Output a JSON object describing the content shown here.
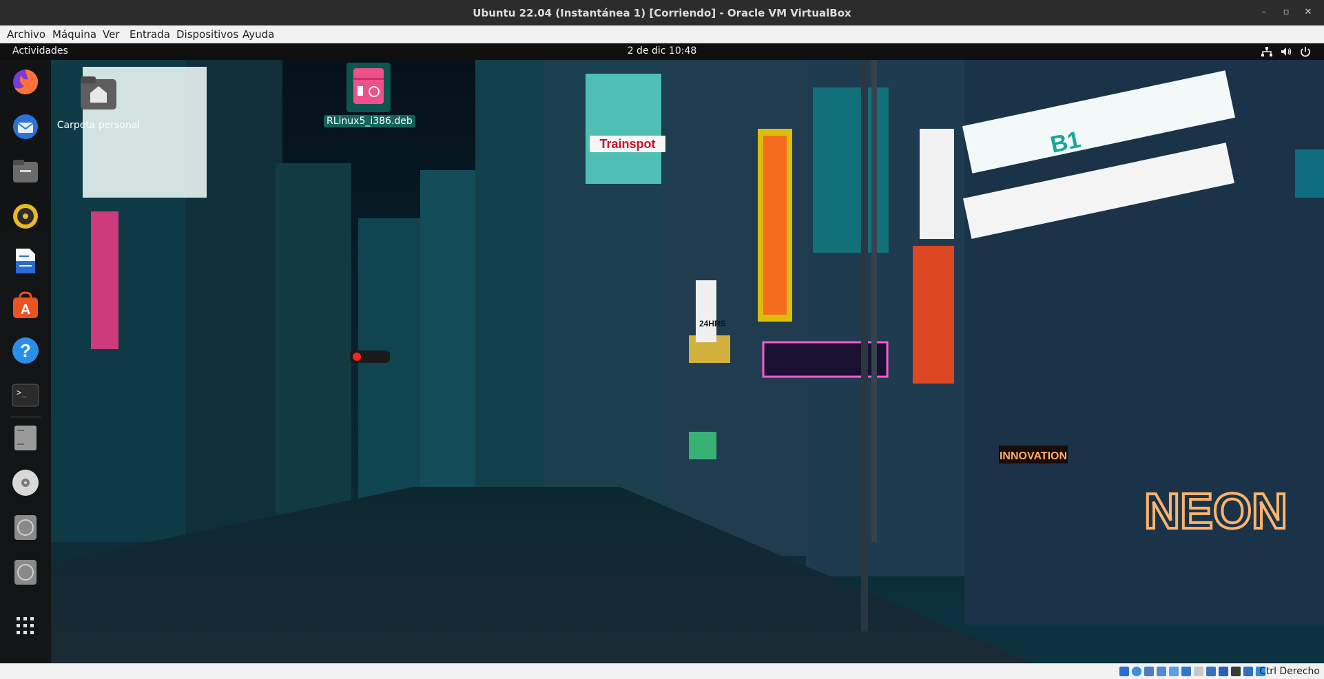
{
  "window": {
    "title": "Ubuntu 22.04 (Instantánea 1) [Corriendo] - Oracle VM VirtualBox"
  },
  "menubar": {
    "items": [
      "Archivo",
      "Máquina",
      "Ver",
      "Entrada",
      "Dispositivos",
      "Ayuda"
    ]
  },
  "guest": {
    "topbar": {
      "activities": "Actividades",
      "clock": "2 de dic  10:48",
      "icons": [
        "network-icon",
        "volume-icon",
        "power-icon"
      ]
    },
    "desktop_icons": [
      {
        "label": "Carpeta personal",
        "icon": "home-folder-icon"
      },
      {
        "label": "RLinux5_i386.deb",
        "icon": "deb-package-icon"
      }
    ],
    "dock": [
      {
        "name": "firefox-icon",
        "color": "#ff7139"
      },
      {
        "name": "thunderbird-icon",
        "color": "#2a74d9"
      },
      {
        "name": "files-icon",
        "color": "#6b6b6b"
      },
      {
        "name": "rhythmbox-icon",
        "color": "#e8b923"
      },
      {
        "name": "libreoffice-writer-icon",
        "color": "#2b6bd1"
      },
      {
        "name": "app-center-icon",
        "color": "#e95420"
      },
      {
        "name": "help-icon",
        "color": "#2a8fe8"
      },
      {
        "name": "terminal-icon",
        "color": "#2b2b2b"
      },
      {
        "name": "drive-icon",
        "color": "#9a9a9a"
      },
      {
        "name": "dvd-icon",
        "color": "#d8d8d8"
      },
      {
        "name": "optical-drive-icon",
        "color": "#8a8a8a"
      },
      {
        "name": "optical-drive-2-icon",
        "color": "#8a8a8a"
      },
      {
        "name": "show-apps-icon",
        "color": "#e0e0e0"
      }
    ],
    "wallpaper_signs": [
      "NEON",
      "INNOVATION",
      "Trainspot",
      "24HRS",
      "B1"
    ]
  },
  "statusbar": {
    "host_key": "Ctrl Derecho"
  }
}
